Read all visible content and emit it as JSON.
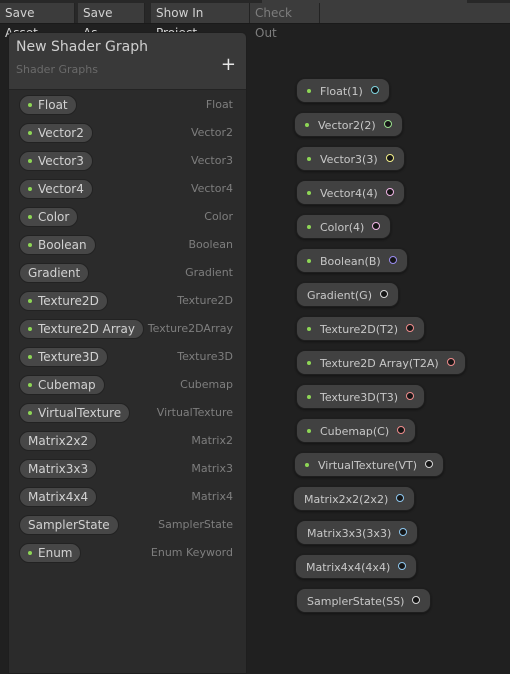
{
  "toolbar": {
    "buttons": [
      {
        "label": "Save Asset",
        "enabled": true
      },
      {
        "label": "Save As...",
        "enabled": true
      },
      {
        "label": "Show In Project",
        "enabled": true
      },
      {
        "label": "Check Out",
        "enabled": false
      }
    ]
  },
  "blackboard": {
    "title": "New Shader Graph",
    "subtitle": "Shader Graphs",
    "add_icon": "plus-icon",
    "items": [
      {
        "label": "Float",
        "type": "Float",
        "exposed": true
      },
      {
        "label": "Vector2",
        "type": "Vector2",
        "exposed": true
      },
      {
        "label": "Vector3",
        "type": "Vector3",
        "exposed": true
      },
      {
        "label": "Vector4",
        "type": "Vector4",
        "exposed": true
      },
      {
        "label": "Color",
        "type": "Color",
        "exposed": true
      },
      {
        "label": "Boolean",
        "type": "Boolean",
        "exposed": true
      },
      {
        "label": "Gradient",
        "type": "Gradient",
        "exposed": false
      },
      {
        "label": "Texture2D",
        "type": "Texture2D",
        "exposed": true
      },
      {
        "label": "Texture2D Array",
        "type": "Texture2DArray",
        "exposed": true
      },
      {
        "label": "Texture3D",
        "type": "Texture3D",
        "exposed": true
      },
      {
        "label": "Cubemap",
        "type": "Cubemap",
        "exposed": true
      },
      {
        "label": "VirtualTexture",
        "type": "VirtualTexture",
        "exposed": true
      },
      {
        "label": "Matrix2x2",
        "type": "Matrix2",
        "exposed": false
      },
      {
        "label": "Matrix3x3",
        "type": "Matrix3",
        "exposed": false
      },
      {
        "label": "Matrix4x4",
        "type": "Matrix4",
        "exposed": false
      },
      {
        "label": "SamplerState",
        "type": "SamplerState",
        "exposed": false
      },
      {
        "label": "Enum",
        "type": "Enum Keyword",
        "exposed": true
      }
    ]
  },
  "graph": {
    "nodes": [
      {
        "label": "Float(1)",
        "exposed": true,
        "port_color": "#7fd4e0"
      },
      {
        "label": "Vector2(2)",
        "exposed": true,
        "port_color": "#9be28f"
      },
      {
        "label": "Vector3(3)",
        "exposed": true,
        "port_color": "#f4f08a"
      },
      {
        "label": "Vector4(4)",
        "exposed": true,
        "port_color": "#f0b5e6"
      },
      {
        "label": "Color(4)",
        "exposed": true,
        "port_color": "#f0b5e6"
      },
      {
        "label": "Boolean(B)",
        "exposed": true,
        "port_color": "#9a8cf0"
      },
      {
        "label": "Gradient(G)",
        "exposed": false,
        "port_color": "#d8d8d8"
      },
      {
        "label": "Texture2D(T2)",
        "exposed": true,
        "port_color": "#f08c8c"
      },
      {
        "label": "Texture2D Array(T2A)",
        "exposed": true,
        "port_color": "#f08c8c"
      },
      {
        "label": "Texture3D(T3)",
        "exposed": true,
        "port_color": "#f08c8c"
      },
      {
        "label": "Cubemap(C)",
        "exposed": true,
        "port_color": "#f08c8c"
      },
      {
        "label": "VirtualTexture(VT)",
        "exposed": true,
        "port_color": "#d8d8d8"
      },
      {
        "label": "Matrix2x2(2x2)",
        "exposed": false,
        "port_color": "#8ec8f0"
      },
      {
        "label": "Matrix3x3(3x3)",
        "exposed": false,
        "port_color": "#8ec8f0"
      },
      {
        "label": "Matrix4x4(4x4)",
        "exposed": false,
        "port_color": "#8ec8f0"
      },
      {
        "label": "SamplerState(SS)",
        "exposed": false,
        "port_color": "#d8d8d8"
      }
    ]
  }
}
